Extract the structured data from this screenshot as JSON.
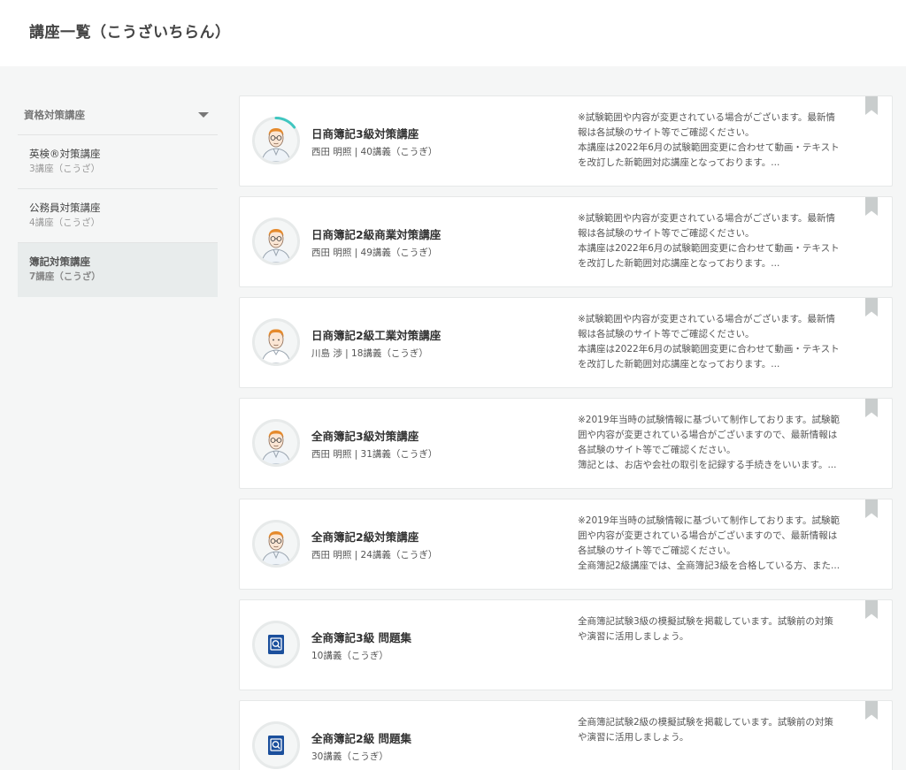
{
  "page": {
    "title": "講座一覧（こうざいちらん）"
  },
  "sidebar": {
    "header_label": "資格対策講座",
    "items": [
      {
        "name": "英検®対策講座",
        "count": "3講座（こうざ）"
      },
      {
        "name": "公務員対策講座",
        "count": "4講座（こうざ）"
      },
      {
        "name": "簿記対策講座",
        "count": "7講座（こうざ）"
      }
    ]
  },
  "courses": [
    {
      "title": "日商簿記3級対策講座",
      "meta": "西田 明照 | 40講義（こうぎ）",
      "description": "※試験範囲や内容が変更されている場合がございます。最新情\n報は各試験のサイト等でご確認ください。\n本講座は2022年6月の試験範囲変更に合わせて動画・テキスト\nを改訂した新範囲対応講座となっております。...",
      "icon": "instructor-avatar-icon",
      "progress": 0.15
    },
    {
      "title": "日商簿記2級商業対策講座",
      "meta": "西田 明照 | 49講義（こうぎ）",
      "description": "※試験範囲や内容が変更されている場合がございます。最新情\n報は各試験のサイト等でご確認ください。\n本講座は2022年6月の試験範囲変更に合わせて動画・テキスト\nを改訂した新範囲対応講座となっております。...",
      "icon": "instructor-avatar-icon"
    },
    {
      "title": "日商簿記2級工業対策講座",
      "meta": "川島 渉 | 18講義（こうぎ）",
      "description": "※試験範囲や内容が変更されている場合がございます。最新情\n報は各試験のサイト等でご確認ください。\n本講座は2022年6月の試験範囲変更に合わせて動画・テキスト\nを改訂した新範囲対応講座となっております。...",
      "icon": "instructor-avatar-icon"
    },
    {
      "title": "全商簿記3級対策講座",
      "meta": "西田 明照 | 31講義（こうぎ）",
      "description": "※2019年当時の試験情報に基づいて制作しております。試験範\n囲や内容が変更されている場合がございますので、最新情報は\n各試験のサイト等でご確認ください。\n簿記とは、お店や会社の取引を記録する手続きをいいます。...",
      "icon": "instructor-avatar-icon"
    },
    {
      "title": "全商簿記2級対策講座",
      "meta": "西田 明照 | 24講義（こうぎ）",
      "description": "※2019年当時の試験情報に基づいて制作しております。試験範\n囲や内容が変更されている場合がございますので、最新情報は\n各試験のサイト等でご確認ください。\n全商簿記2級講座では、全商簿記3級を合格している方、また...",
      "icon": "instructor-avatar-icon"
    },
    {
      "title": "全商簿記3級 問題集",
      "meta": "10講義（こうぎ）",
      "description": "全商簿記試験3級の模擬試験を掲載しています。試験前の対策\nや演習に活用しましょう。",
      "icon": "workbook-icon"
    },
    {
      "title": "全商簿記2級 問題集",
      "meta": "30講義（こうぎ）",
      "description": "全商簿記試験2級の模擬試験を掲載しています。試験前の対策\nや演習に活用しましょう。",
      "icon": "workbook-icon"
    }
  ],
  "colors": {
    "progress_ring": "#3fc6c0",
    "bookmark": "#c9cdcd",
    "workbook_blue": "#1b4f9c"
  }
}
